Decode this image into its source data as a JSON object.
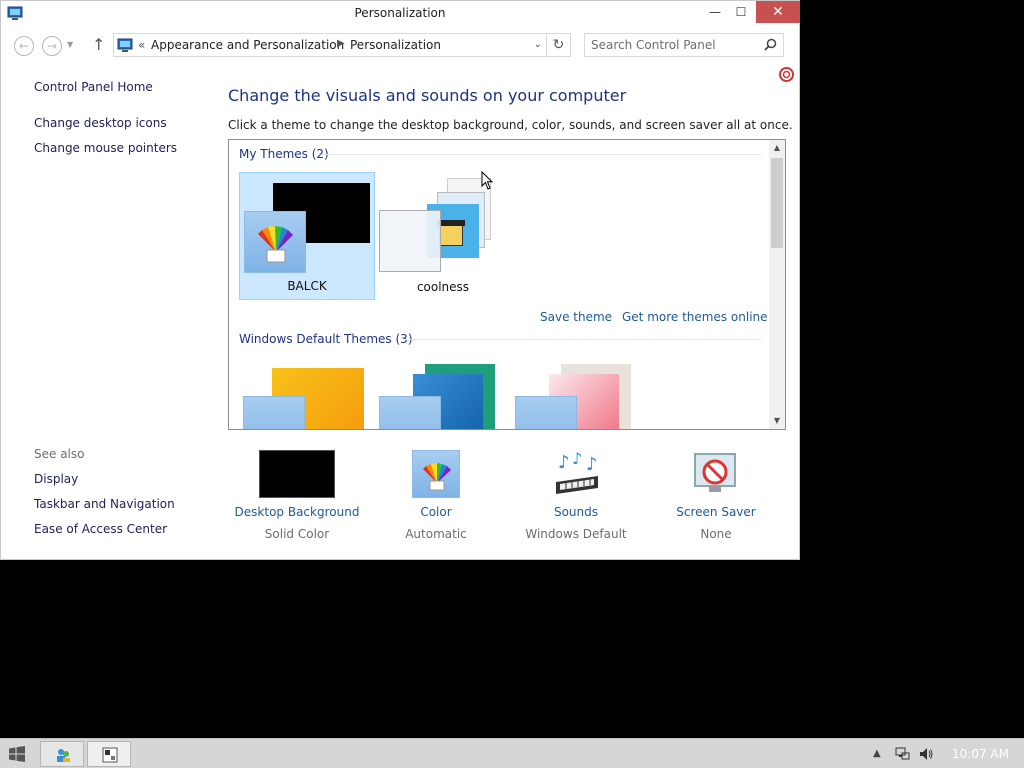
{
  "window": {
    "title": "Personalization",
    "min_label": "—",
    "max_label": "☐",
    "close_label": "✕"
  },
  "navigation": {
    "back_icon": "back-arrow-icon",
    "forward_icon": "forward-arrow-icon",
    "up_icon": "up-arrow-icon",
    "breadcrumb_prefix": "«",
    "breadcrumbs": [
      "Appearance and Personalization",
      "Personalization"
    ],
    "search_placeholder": "Search Control Panel"
  },
  "sidebar": {
    "home": "Control Panel Home",
    "links": [
      "Change desktop icons",
      "Change mouse pointers"
    ],
    "see_also_heading": "See also",
    "see_also": [
      "Display",
      "Taskbar and Navigation",
      "Ease of Access Center"
    ]
  },
  "main": {
    "heading": "Change the visuals and sounds on your computer",
    "description": "Click a theme to change the desktop background, color, sounds, and screen saver all at once.",
    "my_themes_heading": "My Themes (2)",
    "my_themes": [
      {
        "name": "BALCK",
        "selected": true
      },
      {
        "name": "coolness",
        "selected": false
      }
    ],
    "save_theme": "Save theme",
    "get_more": "Get more themes online",
    "default_themes_heading": "Windows Default Themes (3)"
  },
  "settings": [
    {
      "label": "Desktop Background",
      "value": "Solid Color",
      "icon": "desktop-background-icon"
    },
    {
      "label": "Color",
      "value": "Automatic",
      "icon": "color-palette-icon"
    },
    {
      "label": "Sounds",
      "value": "Windows Default",
      "icon": "sounds-icon"
    },
    {
      "label": "Screen Saver",
      "value": "None",
      "icon": "screen-saver-icon"
    }
  ],
  "taskbar": {
    "clock": "10:07 AM"
  },
  "colors": {
    "link": "#1e5a96",
    "heading": "#1e3287",
    "selection": "#cce8ff",
    "close_button": "#c75050"
  }
}
